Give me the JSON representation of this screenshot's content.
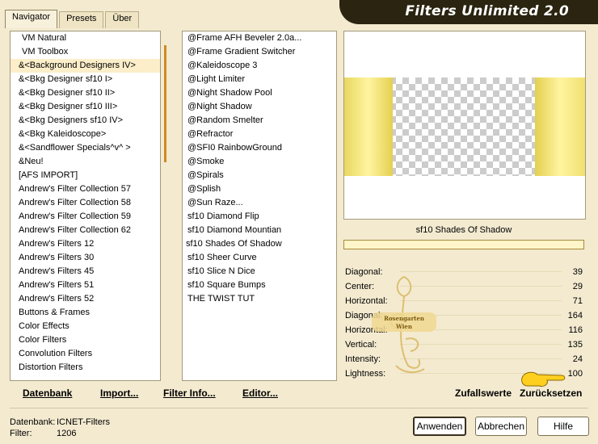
{
  "app": {
    "title": "Filters Unlimited 2.0"
  },
  "tabs": [
    "Navigator",
    "Presets",
    "Über"
  ],
  "categories": [
    "VM Natural",
    "VM Toolbox",
    "&<Background Designers IV>",
    "&<Bkg Designer sf10 I>",
    "&<Bkg Designer sf10 II>",
    "&<Bkg Designer sf10 III>",
    "&<Bkg Designers sf10 IV>",
    "&<Bkg Kaleidoscope>",
    "&<Sandflower Specials^v^ >",
    "&Neu!",
    "[AFS IMPORT]",
    "Andrew's Filter Collection 57",
    "Andrew's Filter Collection 58",
    "Andrew's Filter Collection 59",
    "Andrew's Filter Collection 62",
    "Andrew's Filters 12",
    "Andrew's Filters 30",
    "Andrew's Filters 45",
    "Andrew's Filters 51",
    "Andrew's Filters 52",
    "Buttons & Frames",
    "Color Effects",
    "Color Filters",
    "Convolution Filters",
    "Distortion Filters"
  ],
  "filters": [
    "@Frame AFH Beveler 2.0a...",
    "@Frame Gradient Switcher",
    "@Kaleidoscope 3",
    "@Light Limiter",
    "@Night Shadow Pool",
    "@Night Shadow",
    "@Random Smelter",
    "@Refractor",
    "@SFI0 RainbowGround",
    "@Smoke",
    "@Spirals",
    "@Splish",
    "@Sun Raze...",
    "sf10 Diamond Flip",
    "sf10 Diamond Mountian",
    "sf10 Shades Of Shadow",
    "sf10 Sheer Curve",
    "sf10 Slice N Dice",
    "sf10 Square Bumps",
    "THE TWIST TUT"
  ],
  "selected_category_index": 2,
  "selected_filter_index": 15,
  "preview": {
    "filter_name": "sf10 Shades Of Shadow"
  },
  "params": [
    {
      "label": "Diagonal:",
      "value": "39"
    },
    {
      "label": "Center:",
      "value": "29"
    },
    {
      "label": "Horizontal:",
      "value": "71"
    },
    {
      "label": "Diagonal:",
      "value": "164"
    },
    {
      "label": "Horizontal:",
      "value": "116"
    },
    {
      "label": "Vertical:",
      "value": "135"
    },
    {
      "label": "Intensity:",
      "value": "24"
    },
    {
      "label": "Lightness:",
      "value": "100"
    }
  ],
  "watermark": {
    "line1": "Rosengarten",
    "line2": "Wien"
  },
  "bottom": {
    "datenbank": "Datenbank",
    "import": "Import...",
    "filter_info": "Filter Info...",
    "editor": "Editor...",
    "zufallswerte": "Zufallswerte",
    "zuruecksetzen": "Zurücksetzen"
  },
  "status": {
    "db_label": "Datenbank:",
    "db_value": "ICNET-Filters",
    "filter_label": "Filter:",
    "filter_value": "1206"
  },
  "buttons": {
    "apply": "Anwenden",
    "cancel": "Abbrechen",
    "help": "Hilfe"
  },
  "colors": {
    "accent": "#8c6a12",
    "titlebar": "#2a2410",
    "selection": "#fbeec9"
  }
}
